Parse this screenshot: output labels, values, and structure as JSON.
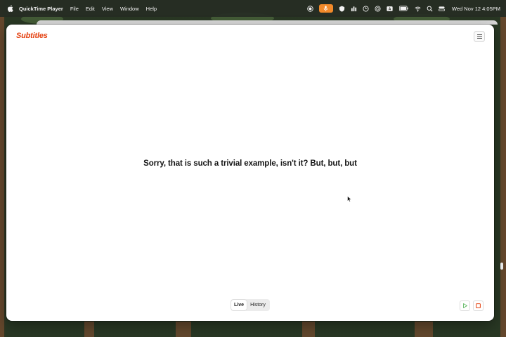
{
  "menubar": {
    "apple_icon": "apple-logo-icon",
    "app_name": "QuickTime Player",
    "menus": [
      "File",
      "Edit",
      "View",
      "Window",
      "Help"
    ],
    "status_icons": [
      "record-icon",
      "microphone-icon",
      "shield-icon",
      "bars-icon",
      "clock-icon",
      "circle-target-icon",
      "keyboard-a-icon",
      "battery-icon",
      "wifi-icon",
      "search-icon",
      "control-center-icon"
    ],
    "keyboard_label": "A",
    "clock": "Wed Nov 12  4:05PM"
  },
  "window": {
    "title": "Subtitles",
    "menu_icon": "hamburger-menu-icon",
    "caption": "Sorry, that is such a trivial example, isn't it? But, but, but",
    "modes": [
      "Live",
      "History"
    ],
    "selected_mode": "Live",
    "play_icon": "play-icon",
    "stop_icon": "stop-icon"
  },
  "colors": {
    "accent": "#e4400f",
    "mic_pill": "#f28a2a",
    "caption_text": "#151515"
  }
}
